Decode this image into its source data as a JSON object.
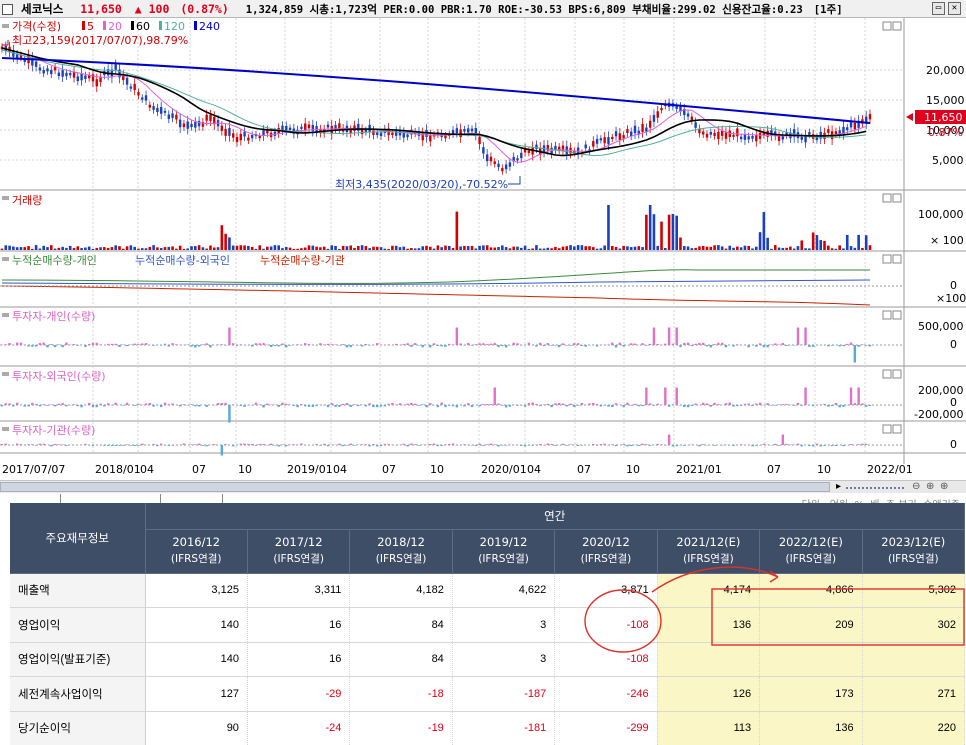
{
  "header": {
    "name": "세코닉스",
    "price": "11,650",
    "change": "▲ 100",
    "change_pct": "(0.87%)",
    "stats": "1,324,859  시총:1,723억 PER:0.00 PBR:1.70 ROE:-30.53 BPS:6,809 부채비율:299.02 신용잔고율:0.23",
    "period": "[1주]",
    "restore_icon": "restore-window-icon",
    "close_icon": "close-icon"
  },
  "price_panel": {
    "legend_title": "가격(수정)",
    "ma": [
      {
        "label": "5",
        "color": "#d40000"
      },
      {
        "label": "20",
        "color": "#e060e0"
      },
      {
        "label": "60",
        "color": "#000000"
      },
      {
        "label": "120",
        "color": "#50b0a0"
      },
      {
        "label": "240",
        "color": "#0000cc"
      }
    ],
    "high_note": "최고23,159(2017/07/07),98.79%",
    "low_note": "최저3,435(2020/03/20),-70.52%",
    "axis": [
      "20,000",
      "15,000",
      "10,000",
      "5,000"
    ],
    "last_price": "11,650",
    "last_pct": "0.87%"
  },
  "volume_panel": {
    "title": "거래량",
    "axis": [
      "100,000",
      "× 100"
    ]
  },
  "cum_panel": {
    "titles": [
      "누적순매수량-개인",
      "누적순매수량-외국인",
      "누적순매수량-기관"
    ],
    "colors": [
      "#3a8a3a",
      "#3355cc",
      "#cc2200"
    ],
    "axis": [
      "0",
      "×100"
    ]
  },
  "indiv_panel": {
    "title": "투자자-개인(수량)",
    "axis": [
      "500,000",
      "0"
    ]
  },
  "foreign_panel": {
    "title": "투자자-외국인(수량)",
    "axis": [
      "200,000",
      "0",
      "-200,000"
    ]
  },
  "inst_panel": {
    "title": "투자자-기관(수량)",
    "axis": [
      "0"
    ]
  },
  "x_axis": [
    "2017/07/07",
    "2018/01",
    "04",
    "07",
    "10",
    "2019/01",
    "04",
    "07",
    "10",
    "2020/01",
    "04",
    "07",
    "10",
    "2021/01",
    "07",
    "10",
    "2022/01"
  ],
  "table": {
    "unit_note": "단위 : 억원, %, 배, 주     분기: 순액기준",
    "corner": "주요재무정보",
    "group": "연간",
    "columns": [
      {
        "period": "2016/12",
        "basis": "(IFRS연결)"
      },
      {
        "period": "2017/12",
        "basis": "(IFRS연결)"
      },
      {
        "period": "2018/12",
        "basis": "(IFRS연결)"
      },
      {
        "period": "2019/12",
        "basis": "(IFRS연결)"
      },
      {
        "period": "2020/12",
        "basis": "(IFRS연결)"
      },
      {
        "period": "2021/12(E)",
        "basis": "(IFRS연결)"
      },
      {
        "period": "2022/12(E)",
        "basis": "(IFRS연결)"
      },
      {
        "period": "2023/12(E)",
        "basis": "(IFRS연결)"
      }
    ],
    "rows": [
      {
        "label": "매출액",
        "values": [
          "3,125",
          "3,311",
          "4,182",
          "4,622",
          "3,871",
          "4,174",
          "4,866",
          "5,302"
        ]
      },
      {
        "label": "영업이익",
        "values": [
          "140",
          "16",
          "84",
          "3",
          "-108",
          "136",
          "209",
          "302"
        ]
      },
      {
        "label": "영업이익(발표기준)",
        "values": [
          "140",
          "16",
          "84",
          "3",
          "-108",
          "",
          "",
          ""
        ]
      },
      {
        "label": "세전계속사업이익",
        "values": [
          "127",
          "-29",
          "-18",
          "-187",
          "-246",
          "126",
          "173",
          "271"
        ]
      },
      {
        "label": "당기순이익",
        "values": [
          "90",
          "-24",
          "-19",
          "-181",
          "-299",
          "113",
          "136",
          "220"
        ]
      }
    ]
  }
}
